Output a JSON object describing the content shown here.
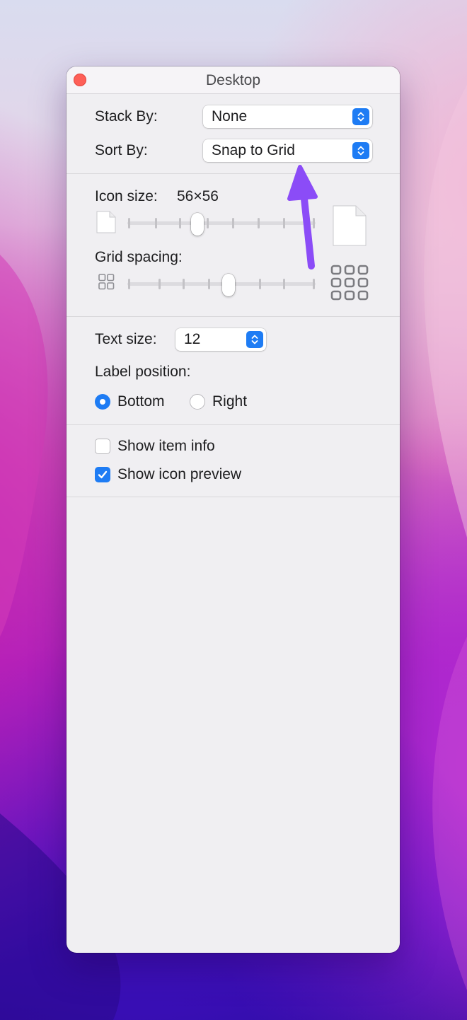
{
  "window": {
    "title": "Desktop"
  },
  "arrange": {
    "stack_by_label": "Stack By:",
    "stack_by_value": "None",
    "sort_by_label": "Sort By:",
    "sort_by_value": "Snap to Grid"
  },
  "icon_settings": {
    "icon_size_label": "Icon size:",
    "icon_size_value": "56×56",
    "icon_size_level": 0.37,
    "grid_spacing_label": "Grid spacing:",
    "grid_spacing_level": 0.54
  },
  "text": {
    "text_size_label": "Text size:",
    "text_size_value": "12",
    "label_position_label": "Label position:",
    "bottom_label": "Bottom",
    "right_label": "Right",
    "selected_position": "Bottom"
  },
  "options": {
    "show_item_info_label": "Show item info",
    "show_item_info_checked": false,
    "show_icon_preview_label": "Show icon preview",
    "show_icon_preview_checked": true
  },
  "colors": {
    "accent": "#1e7cf4",
    "annotation_arrow": "#8b4cf7",
    "close": "#fe5f57"
  },
  "icons": [
    "close-icon",
    "stepper-icon",
    "small-document-icon",
    "large-document-icon",
    "small-grid-icon",
    "large-grid-icon",
    "checkmark-icon",
    "annotation-arrow"
  ]
}
